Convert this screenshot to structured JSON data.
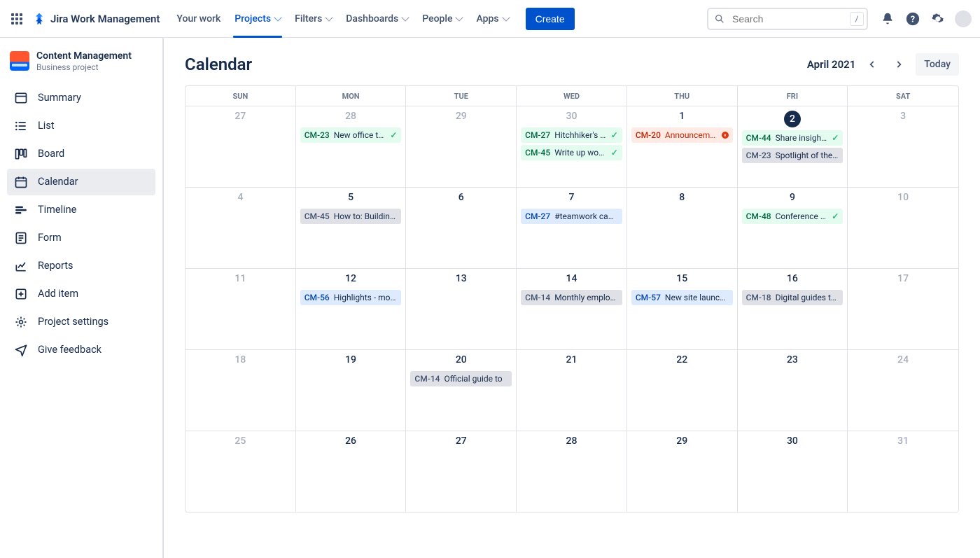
{
  "header": {
    "product": "Jira Work Management",
    "nav": [
      "Your work",
      "Projects",
      "Filters",
      "Dashboards",
      "People",
      "Apps"
    ],
    "nav_active": 1,
    "nav_has_chev": [
      false,
      true,
      true,
      true,
      true,
      true
    ],
    "create": "Create",
    "search_placeholder": "Search",
    "search_hint": "/"
  },
  "sidebar": {
    "project_name": "Content Management",
    "project_sub": "Business project",
    "items": [
      {
        "label": "Summary",
        "icon": "summary"
      },
      {
        "label": "List",
        "icon": "list"
      },
      {
        "label": "Board",
        "icon": "board"
      },
      {
        "label": "Calendar",
        "icon": "calendar",
        "selected": true
      },
      {
        "label": "Timeline",
        "icon": "timeline"
      },
      {
        "label": "Form",
        "icon": "form"
      },
      {
        "label": "Reports",
        "icon": "reports"
      },
      {
        "label": "Add item",
        "icon": "add"
      },
      {
        "label": "Project settings",
        "icon": "settings"
      },
      {
        "label": "Give feedback",
        "icon": "feedback"
      }
    ]
  },
  "main": {
    "title": "Calendar",
    "month": "April 2021",
    "today_label": "Today",
    "day_headers": [
      "SUN",
      "MON",
      "TUE",
      "WED",
      "THU",
      "FRI",
      "SAT"
    ],
    "today_date": "2021-04-02",
    "cells": [
      {
        "n": "27",
        "dim": true
      },
      {
        "n": "28",
        "dim": true,
        "events": [
          {
            "key": "CM-23",
            "title": "New office tour",
            "color": "green",
            "done": true
          }
        ]
      },
      {
        "n": "29",
        "dim": true
      },
      {
        "n": "30",
        "dim": true,
        "events": [
          {
            "key": "CM-27",
            "title": "Hitchhiker's gu...",
            "color": "green",
            "done": true
          },
          {
            "key": "CM-45",
            "title": "Write up works...",
            "color": "green",
            "done": true
          }
        ]
      },
      {
        "n": "1",
        "events": [
          {
            "key": "CM-20",
            "title": "Announcement b..",
            "color": "red",
            "blocked": true
          }
        ]
      },
      {
        "n": "2",
        "today": true,
        "events": [
          {
            "key": "CM-44",
            "title": "Share insights...",
            "color": "green",
            "done": true
          },
          {
            "key": "CM-23",
            "title": "Spotlight of the mo...",
            "color": "grey"
          }
        ]
      },
      {
        "n": "3",
        "dim": true
      },
      {
        "n": "4",
        "dim": true
      },
      {
        "n": "5",
        "events": [
          {
            "key": "CM-45",
            "title": "How to: Building des",
            "color": "grey"
          }
        ]
      },
      {
        "n": "6"
      },
      {
        "n": "7",
        "events": [
          {
            "key": "CM-27",
            "title": "#teamwork campaign",
            "color": "blue"
          }
        ]
      },
      {
        "n": "8"
      },
      {
        "n": "9",
        "events": [
          {
            "key": "CM-48",
            "title": "Conference tour",
            "color": "green",
            "done": true
          }
        ]
      },
      {
        "n": "10",
        "dim": true
      },
      {
        "n": "11",
        "dim": true
      },
      {
        "n": "12",
        "events": [
          {
            "key": "CM-56",
            "title": "Highlights - month of",
            "color": "blue"
          }
        ]
      },
      {
        "n": "13"
      },
      {
        "n": "14",
        "events": [
          {
            "key": "CM-14",
            "title": "Monthly employee ...",
            "color": "grey"
          }
        ]
      },
      {
        "n": "15",
        "events": [
          {
            "key": "CM-57",
            "title": "New site launch blog",
            "color": "blue"
          }
        ]
      },
      {
        "n": "16",
        "events": [
          {
            "key": "CM-18",
            "title": "Digital guides to ex...",
            "color": "grey"
          }
        ]
      },
      {
        "n": "17",
        "dim": true
      },
      {
        "n": "18",
        "dim": true
      },
      {
        "n": "19"
      },
      {
        "n": "20",
        "events": [
          {
            "key": "CM-14",
            "title": "Official guide to",
            "color": "grey"
          }
        ]
      },
      {
        "n": "21"
      },
      {
        "n": "22"
      },
      {
        "n": "23"
      },
      {
        "n": "24",
        "dim": true
      },
      {
        "n": "25",
        "dim": true
      },
      {
        "n": "26"
      },
      {
        "n": "27"
      },
      {
        "n": "28"
      },
      {
        "n": "29"
      },
      {
        "n": "30"
      },
      {
        "n": "31",
        "dim": true
      }
    ]
  }
}
